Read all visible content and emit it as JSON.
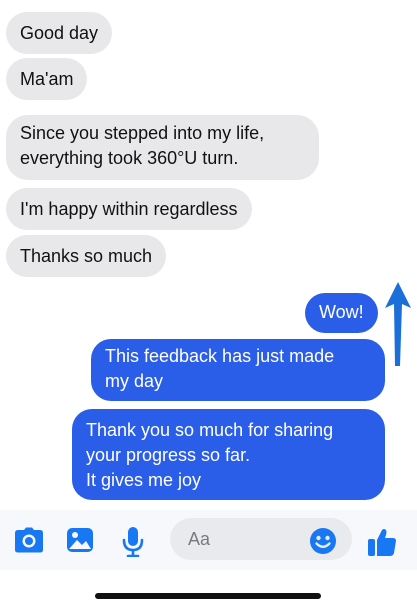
{
  "conversation": {
    "incoming": [
      {
        "text": "Good day"
      },
      {
        "text": "Ma'am"
      },
      {
        "text": "Since you stepped into my life,\neverything took 360°U turn."
      },
      {
        "text": "I'm happy within regardless"
      },
      {
        "text": "Thanks so much"
      }
    ],
    "outgoing": [
      {
        "text": "Wow!"
      },
      {
        "text": "This feedback has just made\nmy day"
      },
      {
        "text": "Thank you so much for sharing\nyour progress so far.\nIt gives me joy"
      }
    ]
  },
  "composer": {
    "placeholder": "Aa",
    "icons": [
      "camera-icon",
      "photo-icon",
      "microphone-icon",
      "emoji-icon",
      "thumbs-up-icon"
    ]
  },
  "colors": {
    "outgoing_bubble": "#2b5ee8",
    "incoming_bubble": "#e8e8ea",
    "accent": "#1877f2",
    "arrow_annotation": "#1a6fd8"
  }
}
